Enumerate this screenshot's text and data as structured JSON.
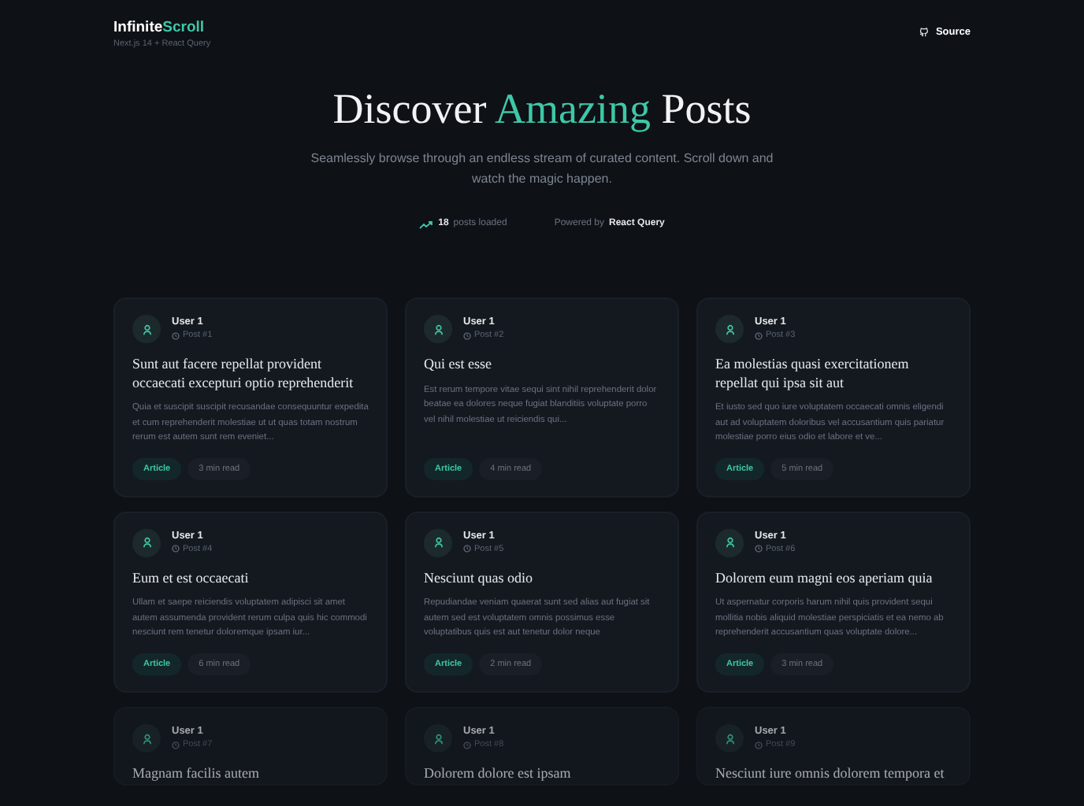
{
  "header": {
    "logo_parts": [
      "Infinite",
      "Scroll"
    ],
    "subtitle": "Next.js 14 + React Query",
    "source_link": "Source"
  },
  "hero": {
    "title_parts": [
      "Discover ",
      "Amazing",
      " Posts"
    ],
    "description": "Seamlessly browse through an endless stream of curated content. Scroll down and watch the magic happen.",
    "posts_count": "18",
    "posts_label": "posts loaded",
    "powered_label": "Powered by",
    "powered_name": "React Query"
  },
  "posts": [
    {
      "author": "User 1",
      "post_number": "Post #1",
      "title": "Sunt aut facere repellat provident occaecati excepturi optio reprehenderit",
      "excerpt": "Quia et suscipit suscipit recusandae consequuntur expedita et cum reprehenderit molestiae ut ut quas totam nostrum rerum est autem sunt rem eveniet...",
      "tag": "Article",
      "read_time": "3 min read"
    },
    {
      "author": "User 1",
      "post_number": "Post #2",
      "title": "Qui est esse",
      "excerpt": "Est rerum tempore vitae sequi sint nihil reprehenderit dolor beatae ea dolores neque fugiat blanditiis voluptate porro vel nihil molestiae ut reiciendis qui...",
      "tag": "Article",
      "read_time": "4 min read"
    },
    {
      "author": "User 1",
      "post_number": "Post #3",
      "title": "Ea molestias quasi exercitationem repellat qui ipsa sit aut",
      "excerpt": "Et iusto sed quo iure voluptatem occaecati omnis eligendi aut ad voluptatem doloribus vel accusantium quis pariatur molestiae porro eius odio et labore et ve...",
      "tag": "Article",
      "read_time": "5 min read"
    },
    {
      "author": "User 1",
      "post_number": "Post #4",
      "title": "Eum et est occaecati",
      "excerpt": "Ullam et saepe reiciendis voluptatem adipisci sit amet autem assumenda provident rerum culpa quis hic commodi nesciunt rem tenetur doloremque ipsam iur...",
      "tag": "Article",
      "read_time": "6 min read"
    },
    {
      "author": "User 1",
      "post_number": "Post #5",
      "title": "Nesciunt quas odio",
      "excerpt": "Repudiandae veniam quaerat sunt sed alias aut fugiat sit autem sed est voluptatem omnis possimus esse voluptatibus quis est aut tenetur dolor neque",
      "tag": "Article",
      "read_time": "2 min read"
    },
    {
      "author": "User 1",
      "post_number": "Post #6",
      "title": "Dolorem eum magni eos aperiam quia",
      "excerpt": "Ut aspernatur corporis harum nihil quis provident sequi mollitia nobis aliquid molestiae perspiciatis et ea nemo ab reprehenderit accusantium quas voluptate dolore...",
      "tag": "Article",
      "read_time": "3 min read"
    },
    {
      "author": "User 1",
      "post_number": "Post #7",
      "title": "Magnam facilis autem"
    },
    {
      "author": "User 1",
      "post_number": "Post #8",
      "title": "Dolorem dolore est ipsam"
    },
    {
      "author": "User 1",
      "post_number": "Post #9",
      "title": "Nesciunt iure omnis dolorem tempora et"
    }
  ]
}
